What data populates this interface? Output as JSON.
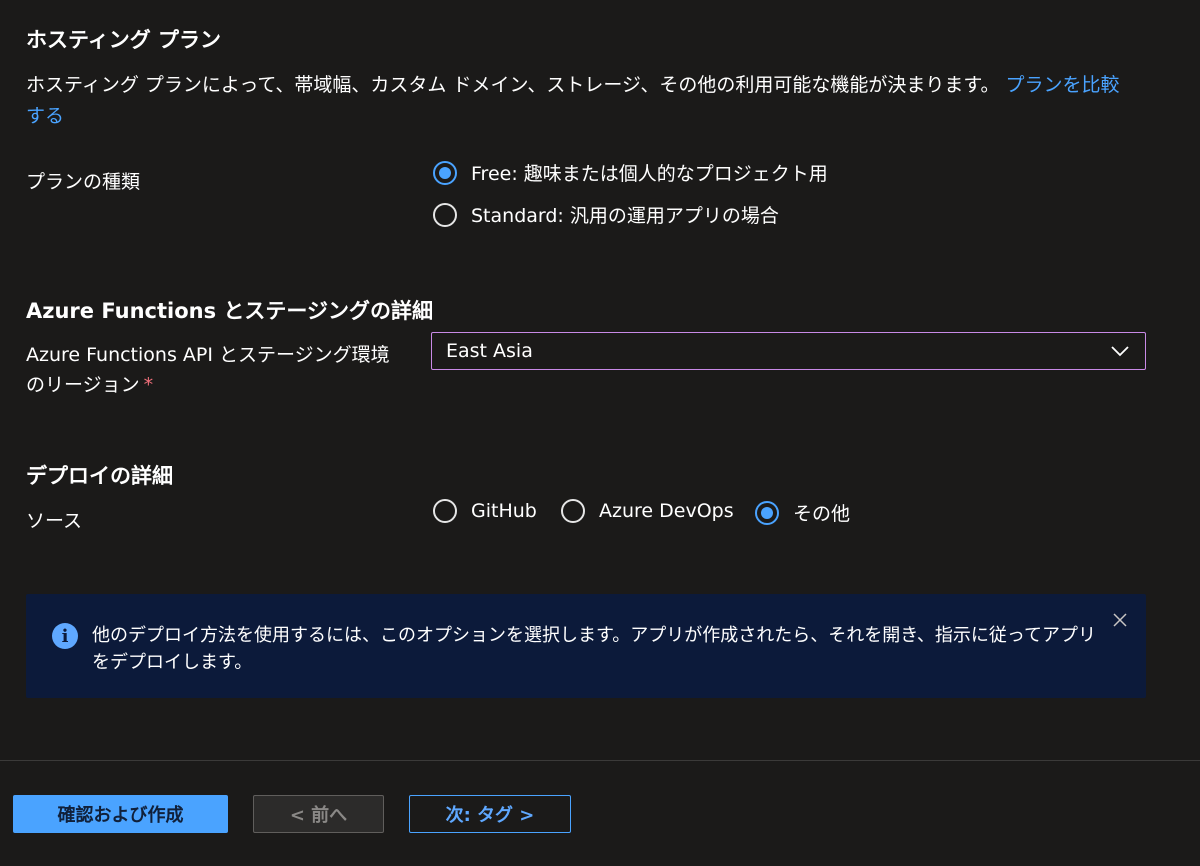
{
  "hosting": {
    "heading": "ホスティング プラン",
    "description": "ホスティング プランによって、帯域幅、カスタム ドメイン、ストレージ、その他の利用可能な機能が決まります。",
    "compare_link": "プランを比較する",
    "plan_type_label": "プランの種類",
    "options": [
      {
        "label": "Free: 趣味または個人的なプロジェクト用",
        "selected": true
      },
      {
        "label": "Standard: 汎用の運用アプリの場合",
        "selected": false
      }
    ]
  },
  "functions": {
    "heading": "Azure Functions とステージングの詳細",
    "region_label_line1": "Azure Functions API とステージング環境",
    "region_label_line2": "のリージョン",
    "required_mark": "*",
    "region_value": "East Asia"
  },
  "deploy": {
    "heading": "デプロイの詳細",
    "source_label": "ソース",
    "sources": [
      {
        "label": "GitHub",
        "selected": false
      },
      {
        "label": "Azure DevOps",
        "selected": false
      },
      {
        "label": "その他",
        "selected": true
      }
    ],
    "info_icon_glyph": "i",
    "info_text": "他のデプロイ方法を使用するには、このオプションを選択します。アプリが作成されたら、それを開き、指示に従ってアプリをデプロイします。"
  },
  "footer": {
    "review_create": "確認および作成",
    "previous": "< 前へ",
    "next": "次: タグ >"
  },
  "icons": {
    "dropdown": "chevron-down-icon",
    "info": "info-icon",
    "close": "close-icon"
  },
  "colors": {
    "background": "#1b1a19",
    "accent": "#4aa3ff",
    "select_border": "#c98ae6",
    "required": "#f1707b",
    "info_background": "#0c1a3a"
  }
}
